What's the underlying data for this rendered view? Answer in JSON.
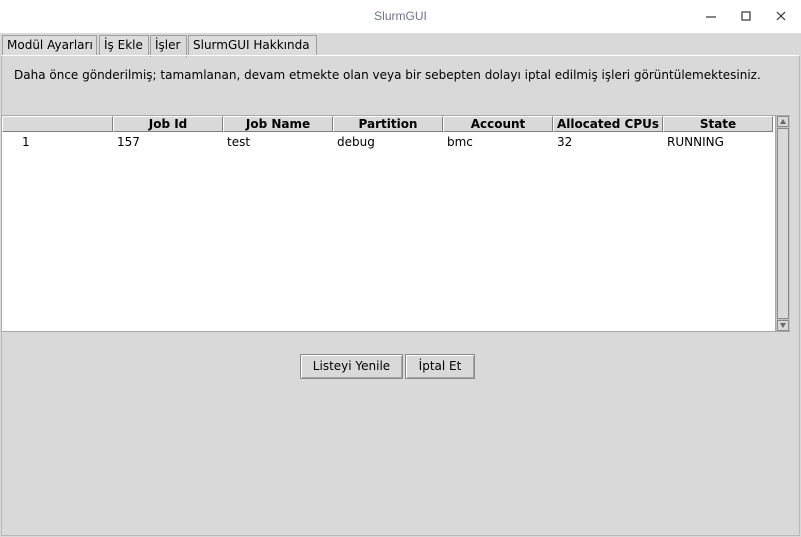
{
  "window": {
    "title": "SlurmGUI"
  },
  "tabs": [
    {
      "label": "Modül Ayarları"
    },
    {
      "label": "İş Ekle"
    },
    {
      "label": "İşler"
    },
    {
      "label": "SlurmGUI Hakkında"
    }
  ],
  "active_tab": "İşler",
  "description": "Daha önce gönderilmiş; tamamlanan, devam etmekte olan veya bir sebepten dolayı iptal edilmiş işleri görüntülemektesiniz.",
  "jobs_table": {
    "columns": [
      "",
      "Job Id",
      "Job Name",
      "Partition",
      "Account",
      "Allocated CPUs",
      "State"
    ],
    "rows": [
      {
        "index": "1",
        "job_id": "157",
        "job_name": "test",
        "partition": "debug",
        "account": "bmc",
        "cpus": "32",
        "state": "RUNNING"
      }
    ]
  },
  "buttons": {
    "refresh": "Listeyi Yenile",
    "cancel": "İptal Et"
  },
  "icons": {
    "minimize": "minimize-icon",
    "maximize": "maximize-icon",
    "close": "close-icon"
  }
}
